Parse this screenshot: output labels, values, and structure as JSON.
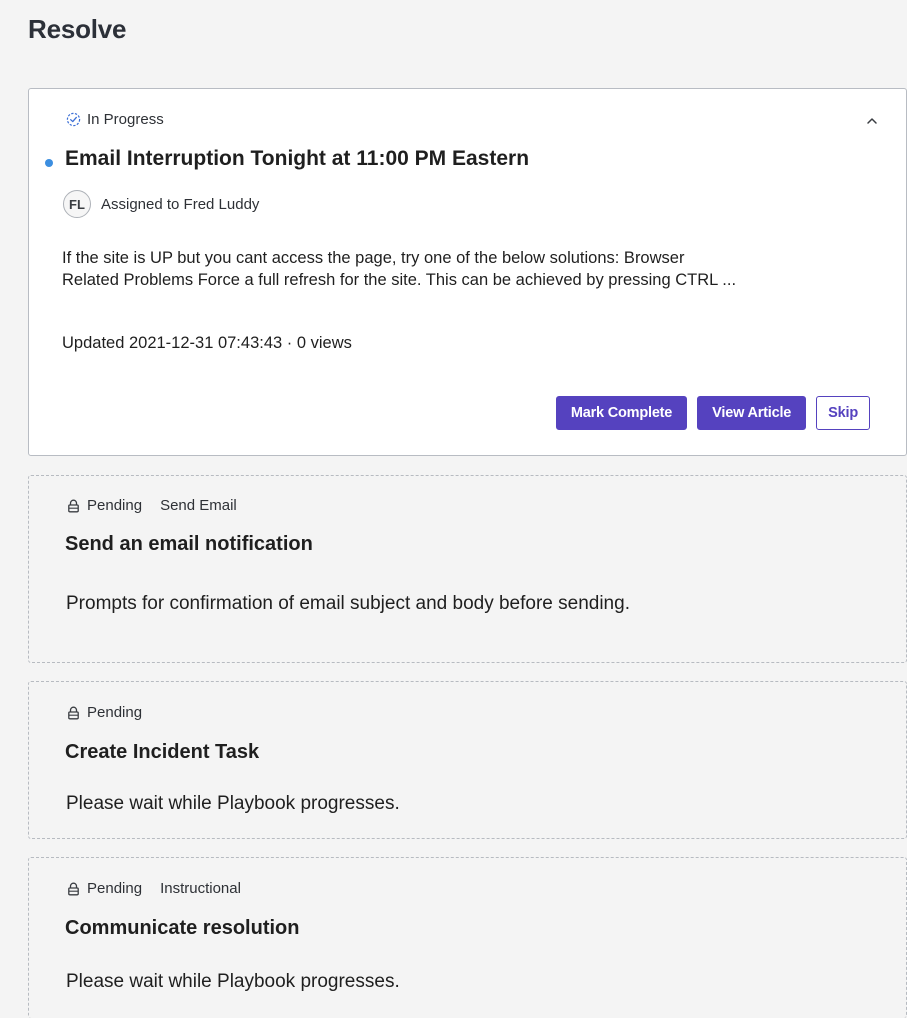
{
  "page": {
    "title": "Resolve"
  },
  "active_task": {
    "status": "In Progress",
    "status_icon": "in-progress-icon",
    "title": "Email Interruption Tonight at 11:00 PM Eastern",
    "assignee_initials": "FL",
    "assignee_label": "Assigned to Fred Luddy",
    "excerpt_line1": " If the site is UP but you cant access the page, try one of the below solutions: Browser",
    "excerpt_line2": "Related Problems Force a full refresh for the site. This can be achieved by pressing CTRL ...",
    "updated": "Updated 2021-12-31 07:43:43 · 0 views",
    "buttons": {
      "mark_complete": "Mark Complete",
      "view_article": "View Article",
      "skip": "Skip"
    },
    "colors": {
      "accent": "#5542bf",
      "unread_dot": "#3c8ee0"
    }
  },
  "pending_tasks": [
    {
      "status": "Pending",
      "tag": "Send Email",
      "title": "Send an email notification",
      "description": "Prompts for confirmation of email subject and body before sending."
    },
    {
      "status": "Pending",
      "tag": "",
      "title": "Create Incident Task",
      "description": "Please wait while Playbook progresses."
    },
    {
      "status": "Pending",
      "tag": "Instructional",
      "title": "Communicate resolution",
      "description": "Please wait while Playbook progresses."
    }
  ]
}
